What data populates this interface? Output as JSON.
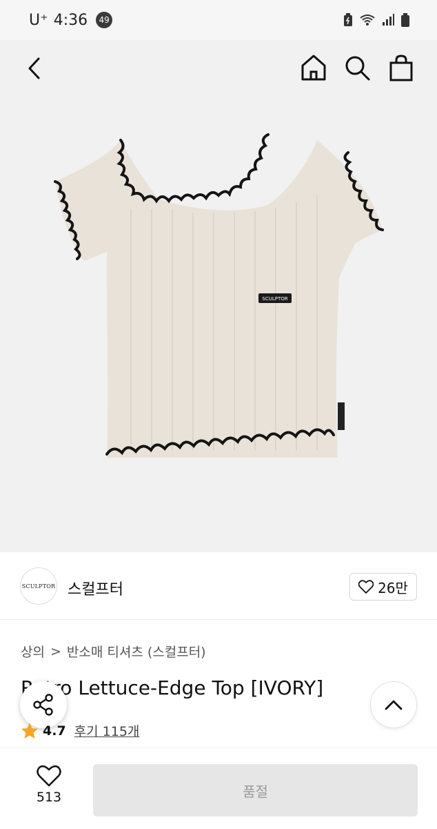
{
  "status_bar": {
    "carrier": "U⁺",
    "time": "4:36",
    "notification_count": "49"
  },
  "product_image": {
    "shirt_color": "#e9e2d9",
    "trim_color": "#141414",
    "label_text": "SCULPTOR"
  },
  "brand": {
    "logo_text": "SCULPTOR",
    "name": "스컬프터",
    "like_count": "26만"
  },
  "breadcrumb": {
    "category": "상의",
    "separator": ">",
    "subcategory": "반소매 티셔츠 (스컬프터)"
  },
  "product": {
    "title": "Retro Lettuce-Edge Top [IVORY]",
    "rating": "4.7",
    "review_label": "후기 115개"
  },
  "bottom_bar": {
    "wish_count": "513",
    "buy_button_label": "품절"
  },
  "icons": [
    "back-arrow-icon",
    "home-icon",
    "search-icon",
    "shopping-bag-icon",
    "heart-icon",
    "share-icon",
    "chevron-up-icon",
    "star-icon"
  ]
}
